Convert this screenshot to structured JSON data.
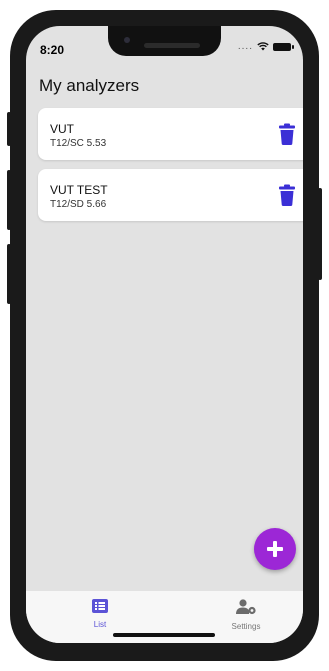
{
  "status": {
    "time": "8:20",
    "dots": "...."
  },
  "page": {
    "title": "My analyzers"
  },
  "analyzers": [
    {
      "name": "VUT",
      "subtitle": "T12/SC 5.53"
    },
    {
      "name": "VUT TEST",
      "subtitle": "T12/SD 5.66"
    }
  ],
  "tabs": [
    {
      "label": "List",
      "icon": "list-icon",
      "active": true
    },
    {
      "label": "Settings",
      "icon": "user-settings-icon",
      "active": false
    }
  ],
  "colors": {
    "accent": "#9c27d6",
    "delete": "#3b2fd6",
    "tab_active": "#5b53d6",
    "background": "#e2e2e2"
  }
}
